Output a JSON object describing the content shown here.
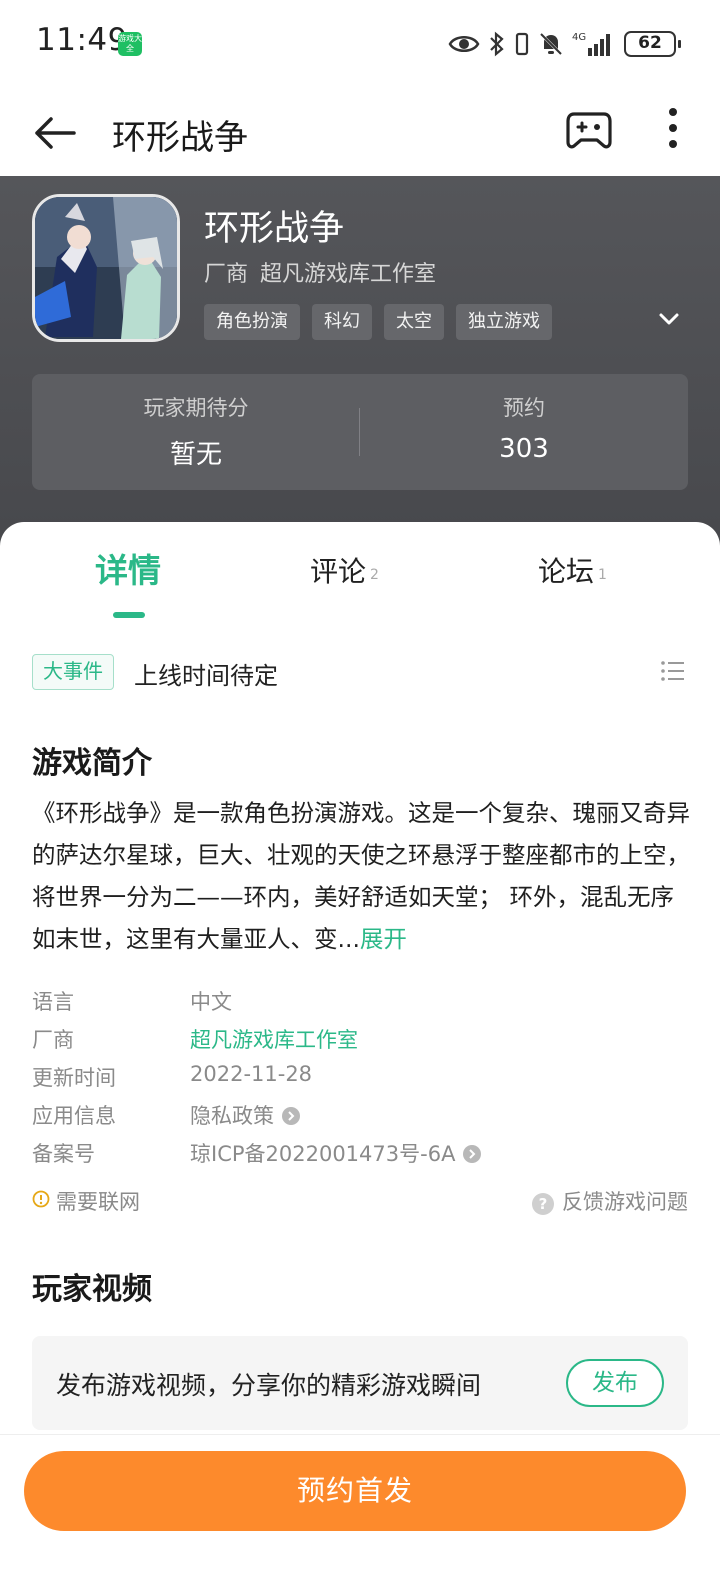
{
  "status_bar": {
    "time": "11:49",
    "app_badge": "游戏大全",
    "battery": "62",
    "network": "4G"
  },
  "app_bar": {
    "title": "环形战争",
    "icons": [
      "back-arrow-icon",
      "gamepad-icon",
      "more-vertical-icon"
    ]
  },
  "game": {
    "title": "环形战争",
    "vendor_label": "厂商",
    "vendor_name": "超凡游戏库工作室",
    "tags": [
      "角色扮演",
      "科幻",
      "太空",
      "独立游戏"
    ],
    "stats": {
      "rating_label": "玩家期待分",
      "rating_value": "暂无",
      "reserve_label": "预约",
      "reserve_value": "303"
    }
  },
  "tabs": [
    {
      "label": "详情",
      "count": "",
      "active": true
    },
    {
      "label": "评论",
      "count": "2",
      "active": false
    },
    {
      "label": "论坛",
      "count": "1",
      "active": false
    }
  ],
  "event": {
    "badge": "大事件",
    "text": "上线时间待定"
  },
  "intro": {
    "title": "游戏简介",
    "text": "《环形战争》是一款角色扮演游戏。这是一个复杂、瑰丽又奇异的萨达尔星球，巨大、壮观的天使之环悬浮于整座都市的上空，将世界一分为二——环内，美好舒适如天堂； 环外，混乱无序如末世，这里有大量亚人、变...",
    "expand": "展开"
  },
  "info": [
    {
      "label": "语言",
      "value": "中文"
    },
    {
      "label": "厂商",
      "value": "超凡游戏库工作室"
    },
    {
      "label": "更新时间",
      "value": "2022-11-28"
    },
    {
      "label": "应用信息",
      "value": "隐私政策"
    },
    {
      "label": "备案号",
      "value": "琼ICP备2022001473号-6A"
    }
  ],
  "network_notice": "需要联网",
  "feedback": "反馈游戏问题",
  "videos": {
    "title": "玩家视频",
    "card_text": "发布游戏视频，分享你的精彩游戏瞬间",
    "publish": "发布"
  },
  "cta": "预约首发",
  "colors": {
    "accent": "#2bb888",
    "cta": "#fd8a2c",
    "header_bg": "#4f5054"
  }
}
